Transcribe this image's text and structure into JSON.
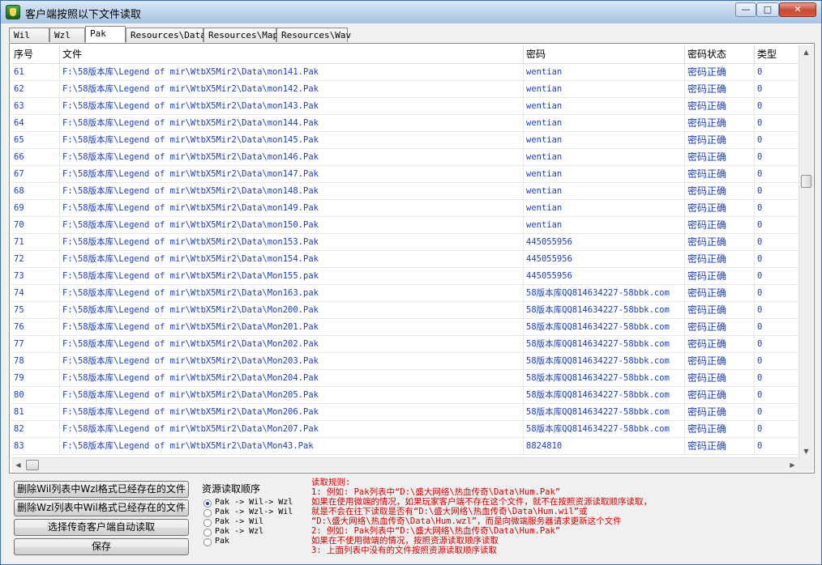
{
  "window": {
    "title": "客户端按照以下文件读取",
    "controls": [
      "minimize",
      "maximize",
      "close"
    ]
  },
  "tabs": [
    {
      "label": "Wil",
      "active": false
    },
    {
      "label": "Wzl",
      "active": false
    },
    {
      "label": "Pak",
      "active": true
    },
    {
      "label": "Resources\\Data",
      "active": false
    },
    {
      "label": "Resources\\Map",
      "active": false
    },
    {
      "label": "Resources\\Wav",
      "active": false
    }
  ],
  "table": {
    "columns": [
      "序号",
      "文件",
      "密码",
      "密码状态",
      "类型"
    ],
    "rows": [
      [
        "61",
        "F:\\58版本库\\Legend of mir\\WtbX5Mir2\\Data\\mon141.Pak",
        "wentian",
        "密码正确",
        "0"
      ],
      [
        "62",
        "F:\\58版本库\\Legend of mir\\WtbX5Mir2\\Data\\mon142.Pak",
        "wentian",
        "密码正确",
        "0"
      ],
      [
        "63",
        "F:\\58版本库\\Legend of mir\\WtbX5Mir2\\Data\\mon143.Pak",
        "wentian",
        "密码正确",
        "0"
      ],
      [
        "64",
        "F:\\58版本库\\Legend of mir\\WtbX5Mir2\\Data\\mon144.Pak",
        "wentian",
        "密码正确",
        "0"
      ],
      [
        "65",
        "F:\\58版本库\\Legend of mir\\WtbX5Mir2\\Data\\mon145.Pak",
        "wentian",
        "密码正确",
        "0"
      ],
      [
        "66",
        "F:\\58版本库\\Legend of mir\\WtbX5Mir2\\Data\\mon146.Pak",
        "wentian",
        "密码正确",
        "0"
      ],
      [
        "67",
        "F:\\58版本库\\Legend of mir\\WtbX5Mir2\\Data\\mon147.Pak",
        "wentian",
        "密码正确",
        "0"
      ],
      [
        "68",
        "F:\\58版本库\\Legend of mir\\WtbX5Mir2\\Data\\mon148.Pak",
        "wentian",
        "密码正确",
        "0"
      ],
      [
        "69",
        "F:\\58版本库\\Legend of mir\\WtbX5Mir2\\Data\\mon149.Pak",
        "wentian",
        "密码正确",
        "0"
      ],
      [
        "70",
        "F:\\58版本库\\Legend of mir\\WtbX5Mir2\\Data\\mon150.Pak",
        "wentian",
        "密码正确",
        "0"
      ],
      [
        "71",
        "F:\\58版本库\\Legend of mir\\WtbX5Mir2\\Data\\mon153.Pak",
        "445055956",
        "密码正确",
        "0"
      ],
      [
        "72",
        "F:\\58版本库\\Legend of mir\\WtbX5Mir2\\Data\\mon154.Pak",
        "445055956",
        "密码正确",
        "0"
      ],
      [
        "73",
        "F:\\58版本库\\Legend of mir\\WtbX5Mir2\\Data\\Mon155.pak",
        "445055956",
        "密码正确",
        "0"
      ],
      [
        "74",
        "F:\\58版本库\\Legend of mir\\WtbX5Mir2\\Data\\Mon163.pak",
        "58版本库QQ814634227-58bbk.com",
        "密码正确",
        "0"
      ],
      [
        "75",
        "F:\\58版本库\\Legend of mir\\WtbX5Mir2\\Data\\Mon200.Pak",
        "58版本库QQ814634227-58bbk.com",
        "密码正确",
        "0"
      ],
      [
        "76",
        "F:\\58版本库\\Legend of mir\\WtbX5Mir2\\Data\\Mon201.Pak",
        "58版本库QQ814634227-58bbk.com",
        "密码正确",
        "0"
      ],
      [
        "77",
        "F:\\58版本库\\Legend of mir\\WtbX5Mir2\\Data\\Mon202.Pak",
        "58版本库QQ814634227-58bbk.com",
        "密码正确",
        "0"
      ],
      [
        "78",
        "F:\\58版本库\\Legend of mir\\WtbX5Mir2\\Data\\Mon203.Pak",
        "58版本库QQ814634227-58bbk.com",
        "密码正确",
        "0"
      ],
      [
        "79",
        "F:\\58版本库\\Legend of mir\\WtbX5Mir2\\Data\\Mon204.Pak",
        "58版本库QQ814634227-58bbk.com",
        "密码正确",
        "0"
      ],
      [
        "80",
        "F:\\58版本库\\Legend of mir\\WtbX5Mir2\\Data\\Mon205.Pak",
        "58版本库QQ814634227-58bbk.com",
        "密码正确",
        "0"
      ],
      [
        "81",
        "F:\\58版本库\\Legend of mir\\WtbX5Mir2\\Data\\Mon206.Pak",
        "58版本库QQ814634227-58bbk.com",
        "密码正确",
        "0"
      ],
      [
        "82",
        "F:\\58版本库\\Legend of mir\\WtbX5Mir2\\Data\\Mon207.Pak",
        "58版本库QQ814634227-58bbk.com",
        "密码正确",
        "0"
      ],
      [
        "83",
        "F:\\58版本库\\Legend of mir\\WtbX5Mir2\\Data\\Mon43.Pak",
        "8824810",
        "密码正确",
        "0"
      ]
    ]
  },
  "buttons": {
    "delete_wil": "删除Wil列表中Wzl格式已经存在的文件",
    "delete_wzl": "删除Wzl列表中Wil格式已经存在的文件",
    "auto_read": "选择传奇客户端自动读取",
    "save": "保存"
  },
  "order": {
    "title": "资源读取顺序",
    "options": [
      {
        "label": "Pak -> Wil-> Wzl",
        "checked": true
      },
      {
        "label": "Pak -> Wzl-> Wil",
        "checked": false
      },
      {
        "label": "Pak -> Wil",
        "checked": false
      },
      {
        "label": "Pak -> Wzl",
        "checked": false
      },
      {
        "label": "Pak",
        "checked": false
      }
    ]
  },
  "rules": {
    "lines": [
      "读取规则:",
      "1: 例如: Pak列表中“D:\\盛大网络\\热血传奇\\Data\\Hum.Pak”",
      "    如果在使用微端的情况，如果玩家客户端不存在这个文件，就不在按照资源读取顺序读取，",
      "    就是不会在往下读取是否有“D:\\盛大网络\\热血传奇\\Data\\Hum.wil”或",
      "   “D:\\盛大网络\\热血传奇\\Data\\Hum.wzl”，而是向微端服务器请求更新这个文件",
      "2: 例如: Pak列表中“D:\\盛大网络\\热血传奇\\Data\\Hum.Pak”",
      "    如果在不使用微端的情况，按照资源读取顺序读取",
      "3: 上面列表中没有的文件按照资源读取顺序读取"
    ]
  },
  "colors": {
    "list_text": "#1f3fb5",
    "rules_text": "#d40000"
  }
}
